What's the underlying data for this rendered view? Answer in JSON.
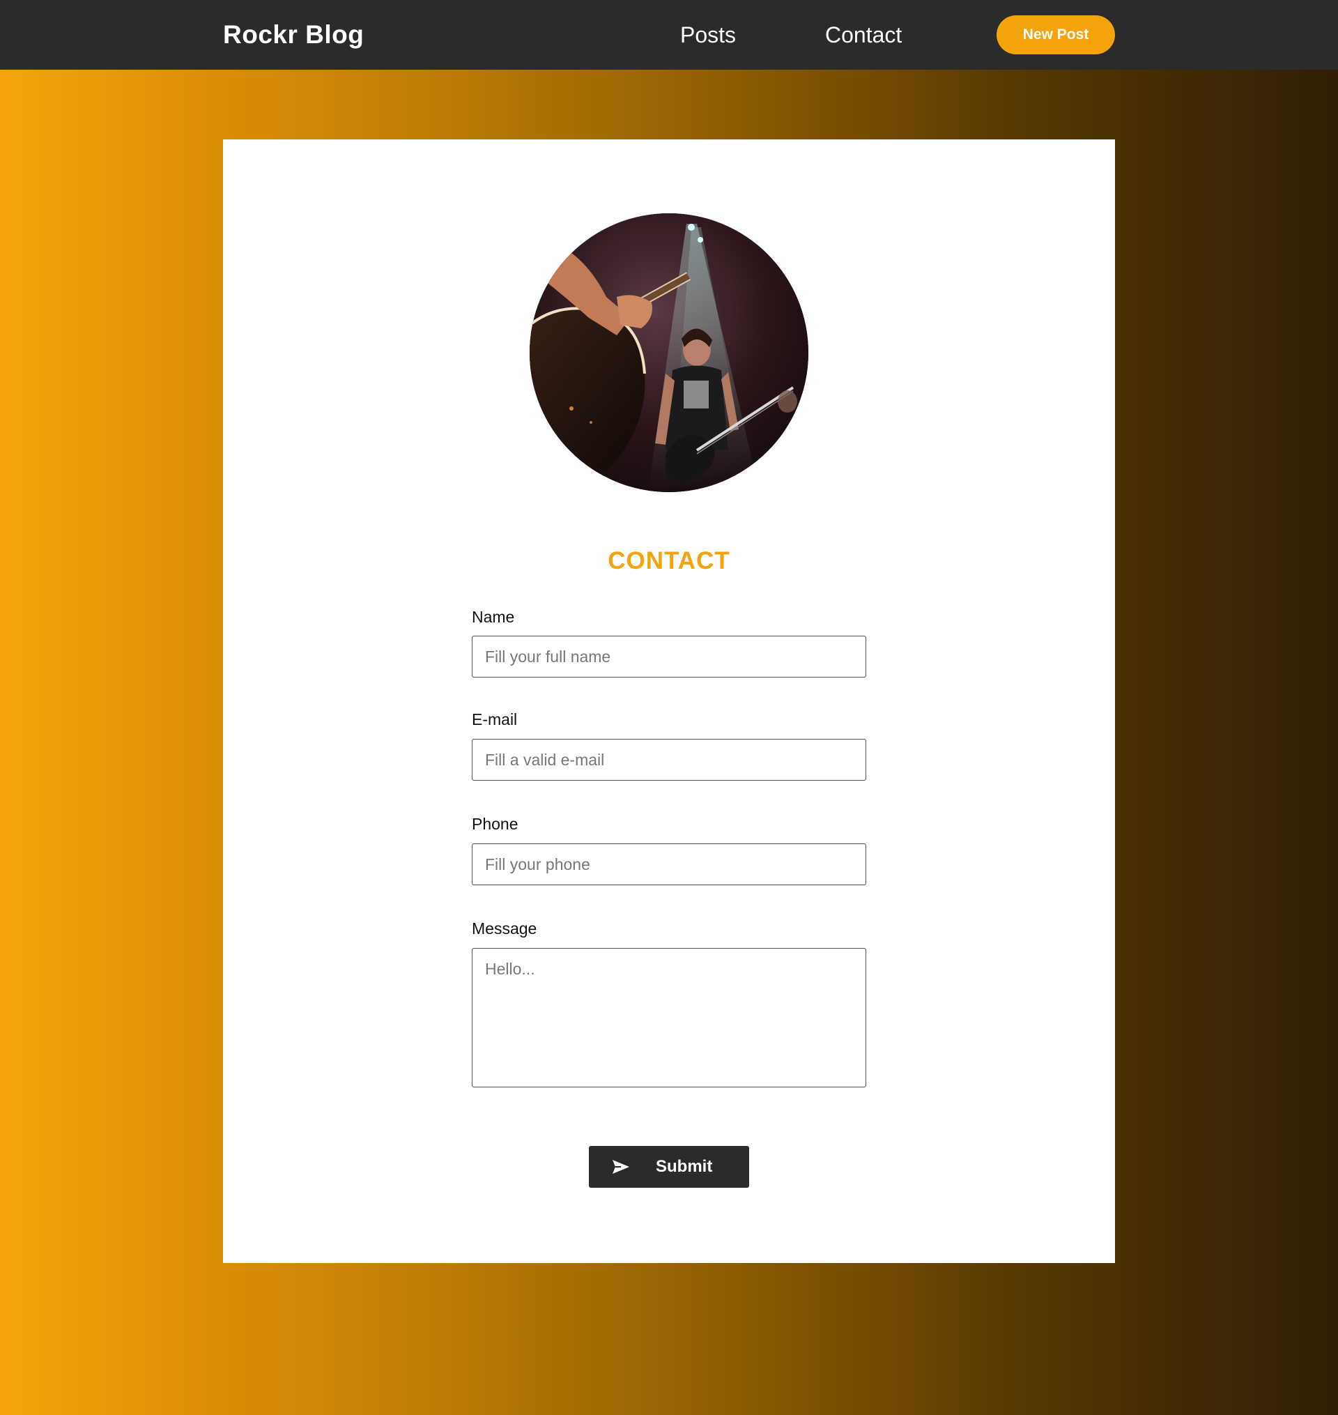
{
  "navbar": {
    "brand": "Rockr  Blog",
    "links": [
      {
        "label": "Posts"
      },
      {
        "label": "Contact"
      }
    ],
    "new_post_label": "New Post"
  },
  "colors": {
    "accent": "#f4a40a",
    "navbar_bg": "#2b2b2b",
    "card_bg": "#ffffff"
  },
  "contact": {
    "avatar_icon": "concert-photo",
    "title": "CONTACT",
    "fields": {
      "name": {
        "label": "Name",
        "placeholder": "Fill your full name"
      },
      "email": {
        "label": "E-mail",
        "placeholder": "Fill a valid e-mail"
      },
      "phone": {
        "label": "Phone",
        "placeholder": "Fill your phone"
      },
      "message": {
        "label": "Message",
        "placeholder": "Hello..."
      }
    },
    "submit_label": "Submit",
    "submit_icon": "send-icon"
  }
}
